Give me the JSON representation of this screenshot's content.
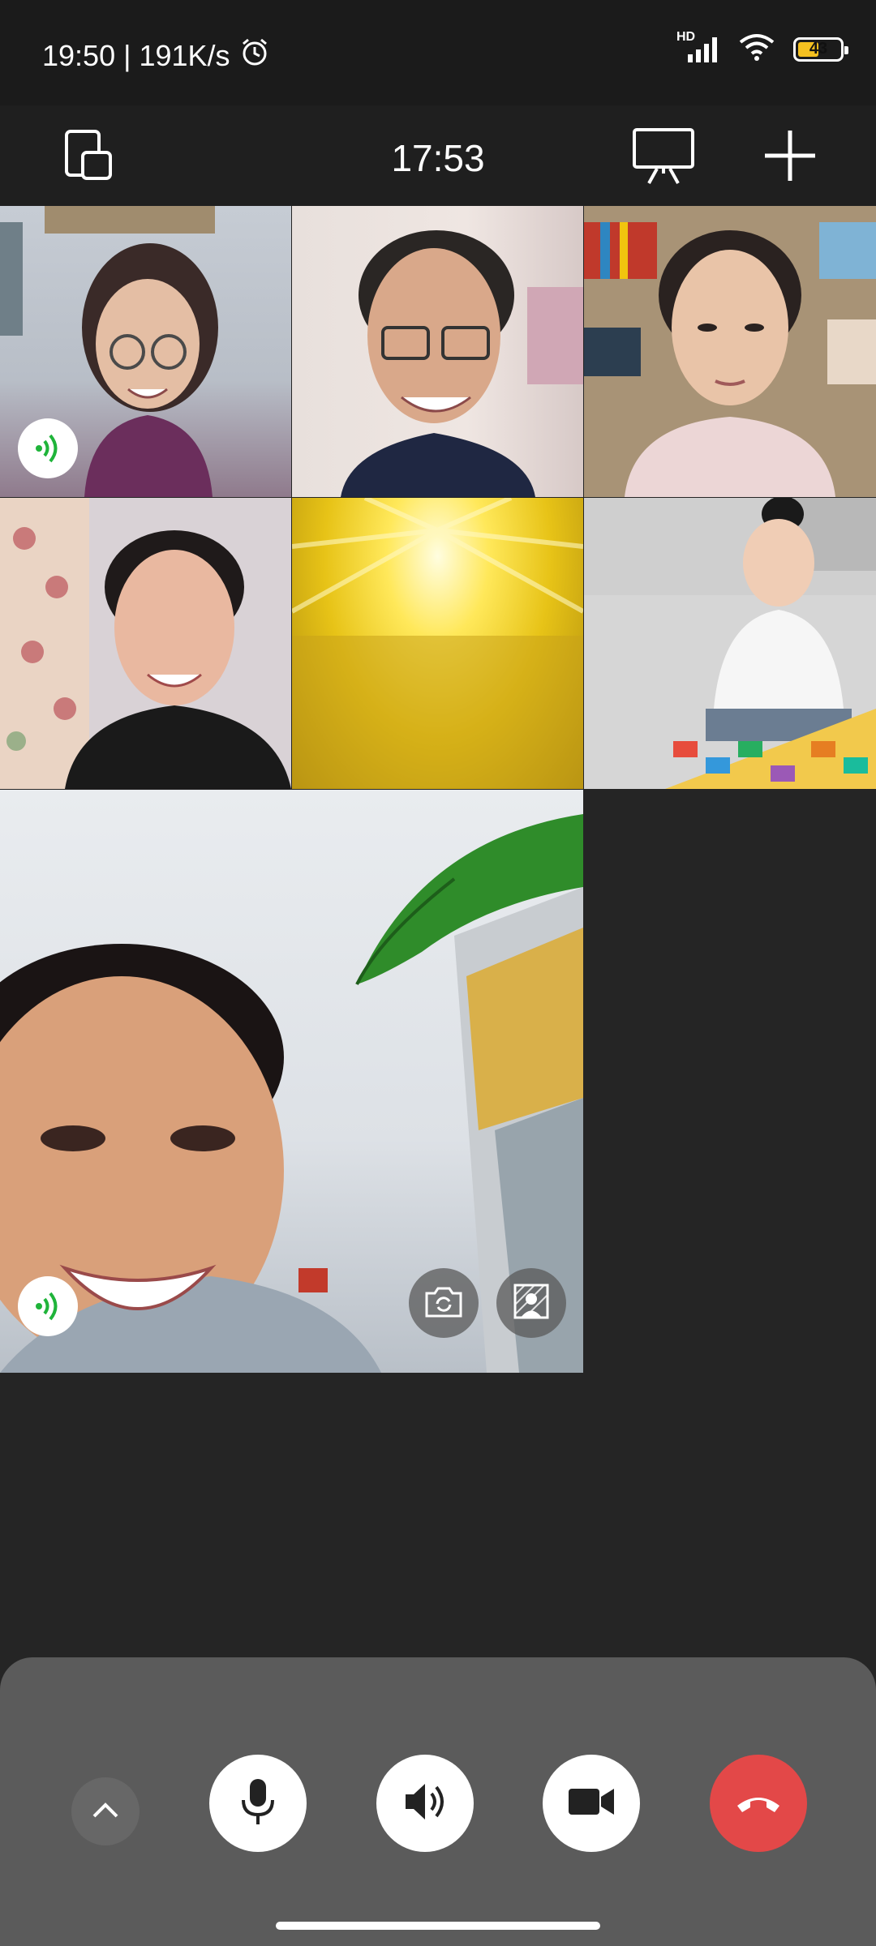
{
  "status_bar": {
    "time_speed": "19:50 | 191K/s",
    "network_label": "HD",
    "battery_level": "43"
  },
  "top_bar": {
    "call_duration": "17:53"
  },
  "colors": {
    "background": "#252525",
    "panel": "#5b5b5b",
    "hangup": "#e34848",
    "speaking": "#1fb43a"
  },
  "icons": {
    "minimize": "minimize-window-icon",
    "screen_share": "screen-share-icon",
    "add": "add-participant-icon",
    "speaking": "speaking-indicator-icon",
    "flip_camera": "flip-camera-icon",
    "background_blur": "background-effect-icon",
    "expand": "chevron-up-icon",
    "mic": "microphone-icon",
    "speaker": "speaker-icon",
    "camera": "video-camera-icon",
    "hangup": "hang-up-icon"
  }
}
